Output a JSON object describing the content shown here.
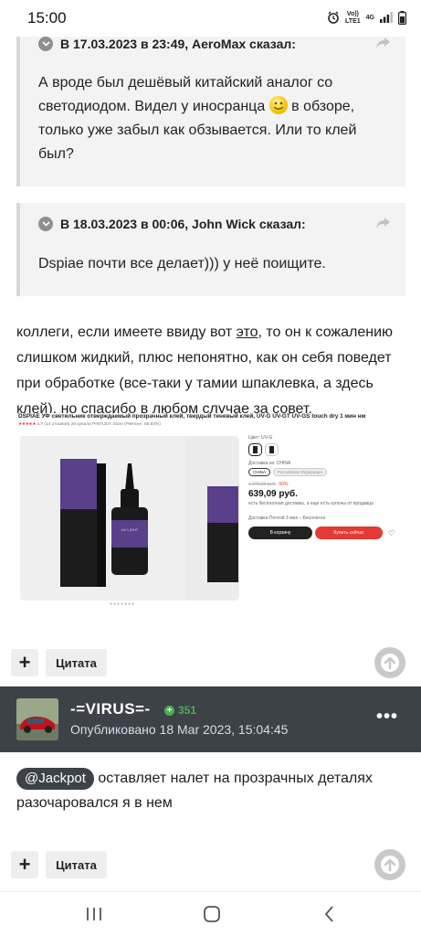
{
  "status_bar": {
    "time": "15:00",
    "net_top": "Vo))",
    "net_bottom": "LTE1",
    "signal_label": "4G"
  },
  "quotes": [
    {
      "header": "В 17.03.2023 в 23:49, AeroMax сказал:",
      "body_part1": "А вроде был дешёвый китайский аналог со светодиодом. Видел у иносранца",
      "body_part2": "в обзоре, только уже забыл как обзывается. Или то клей был?"
    },
    {
      "header": "В 18.03.2023 в 00:06, John Wick сказал:",
      "body": "Dspiae почти все делает))) у неё поищите."
    }
  ],
  "post1": {
    "text_before_link": "коллеги, если имеете ввиду вот ",
    "link_text": "это",
    "text_after_link": ", то он к сожалению слишком жидкий, плюс непонятно, как он себя поведет при обработке (все-таки у тамии шпаклевка, а здесь клей), но спасибо в любом случае за совет."
  },
  "product": {
    "title": "DSPIAE УФ светильник отверждаемый прозрачный клей, твердый теневый клей, UV-G UV-GT UV-GS touch dry 1 мин нм",
    "rating": "4.7",
    "reviews": "(14 отзывов)",
    "bought": "28 купили",
    "store": "PINTUDY Store (Рейтинг: 88.84%)",
    "color_label": "Цвет: UV-G",
    "ship_label": "Доставка из: CHINA",
    "ship_options": [
      "CHINA",
      "Российская Федерация"
    ],
    "old_price": "1 279,03 руб.",
    "discount": "-50%",
    "price": "639,09 руб.",
    "promo": "есть бесплатная доставка, а еще есть купоны от продавца",
    "delivery": "Доставка Почтой 3 мая – Бесплатно",
    "cart_button": "В корзину",
    "buy_button": "Купить сейчас",
    "bottle_label": "UV LIGHT CURING GLUE"
  },
  "actions": {
    "plus": "+",
    "quote_label": "Цитата"
  },
  "author": {
    "name": "-=VIRUS=-",
    "reputation": "351",
    "published": "Опубликовано 18 Mar 2023, 15:04:45",
    "more": "•••"
  },
  "post2": {
    "mention": "@Jackpot",
    "text": " оставляет налет на прозрачных деталях разочаровался я в нем"
  },
  "colors": {
    "author_bar": "#3d4249",
    "reputation": "#4caf50",
    "buy": "#e53935"
  }
}
